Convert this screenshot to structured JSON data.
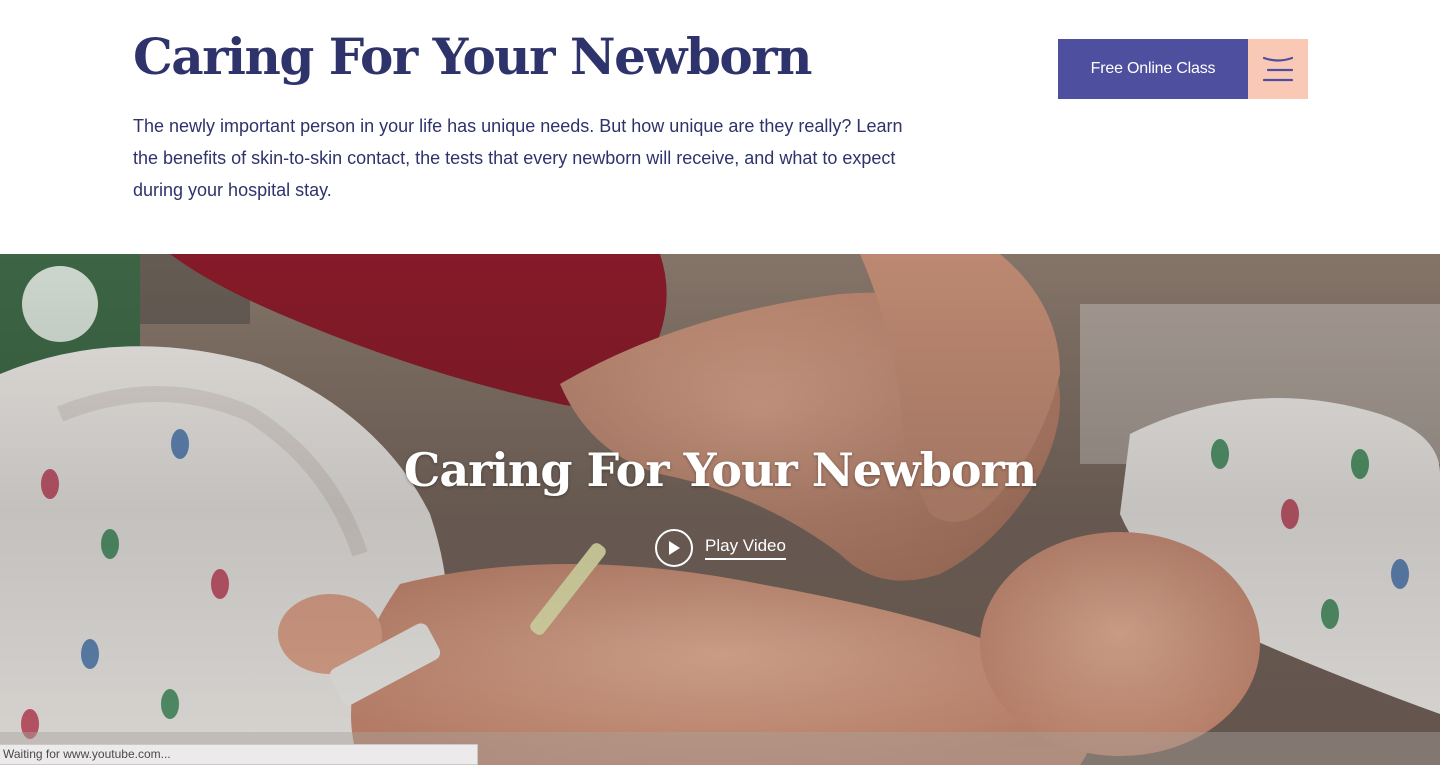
{
  "header": {
    "title": "Caring For Your Newborn",
    "intro": "The newly important person in your life has unique needs. But how unique are they really? Learn the benefits of skin-to-skin contact,  the tests that every newborn will receive, and what to expect during your hospital stay.",
    "cta_label": "Free Online Class",
    "menu_icon": "menu-icon"
  },
  "hero": {
    "title": "Caring For Your Newborn",
    "play_label": "Play Video",
    "play_icon": "play-icon"
  },
  "status_bar": {
    "text": "Waiting for www.youtube.com..."
  },
  "colors": {
    "brand_navy": "#2e336b",
    "cta_purple": "#4f4f9f",
    "menu_peach": "#f9c9b6"
  }
}
